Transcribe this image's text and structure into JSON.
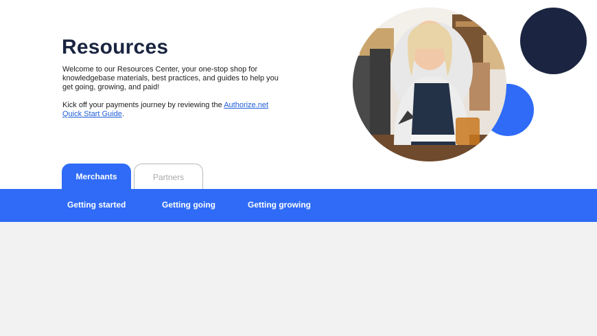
{
  "page": {
    "title": "Resources",
    "intro": "Welcome to our Resources Center, your one-stop shop for knowledgebase materials, best practices, and guides to help you get going, growing, and paid!",
    "journey_prefix": "Kick off your payments journey by reviewing the ",
    "journey_link": "Authorize.net Quick Start Guide",
    "journey_suffix": "."
  },
  "tabs": [
    {
      "label": "Merchants",
      "active": true
    },
    {
      "label": "Partners",
      "active": false
    }
  ],
  "subnav": {
    "items": [
      {
        "label": "Getting started"
      },
      {
        "label": "Getting going"
      },
      {
        "label": "Getting growing"
      }
    ]
  },
  "colors": {
    "brand_blue": "#2f6bf6",
    "navy": "#1b2541",
    "content_bg": "#f2f2f2",
    "link": "#1d5dd8"
  }
}
